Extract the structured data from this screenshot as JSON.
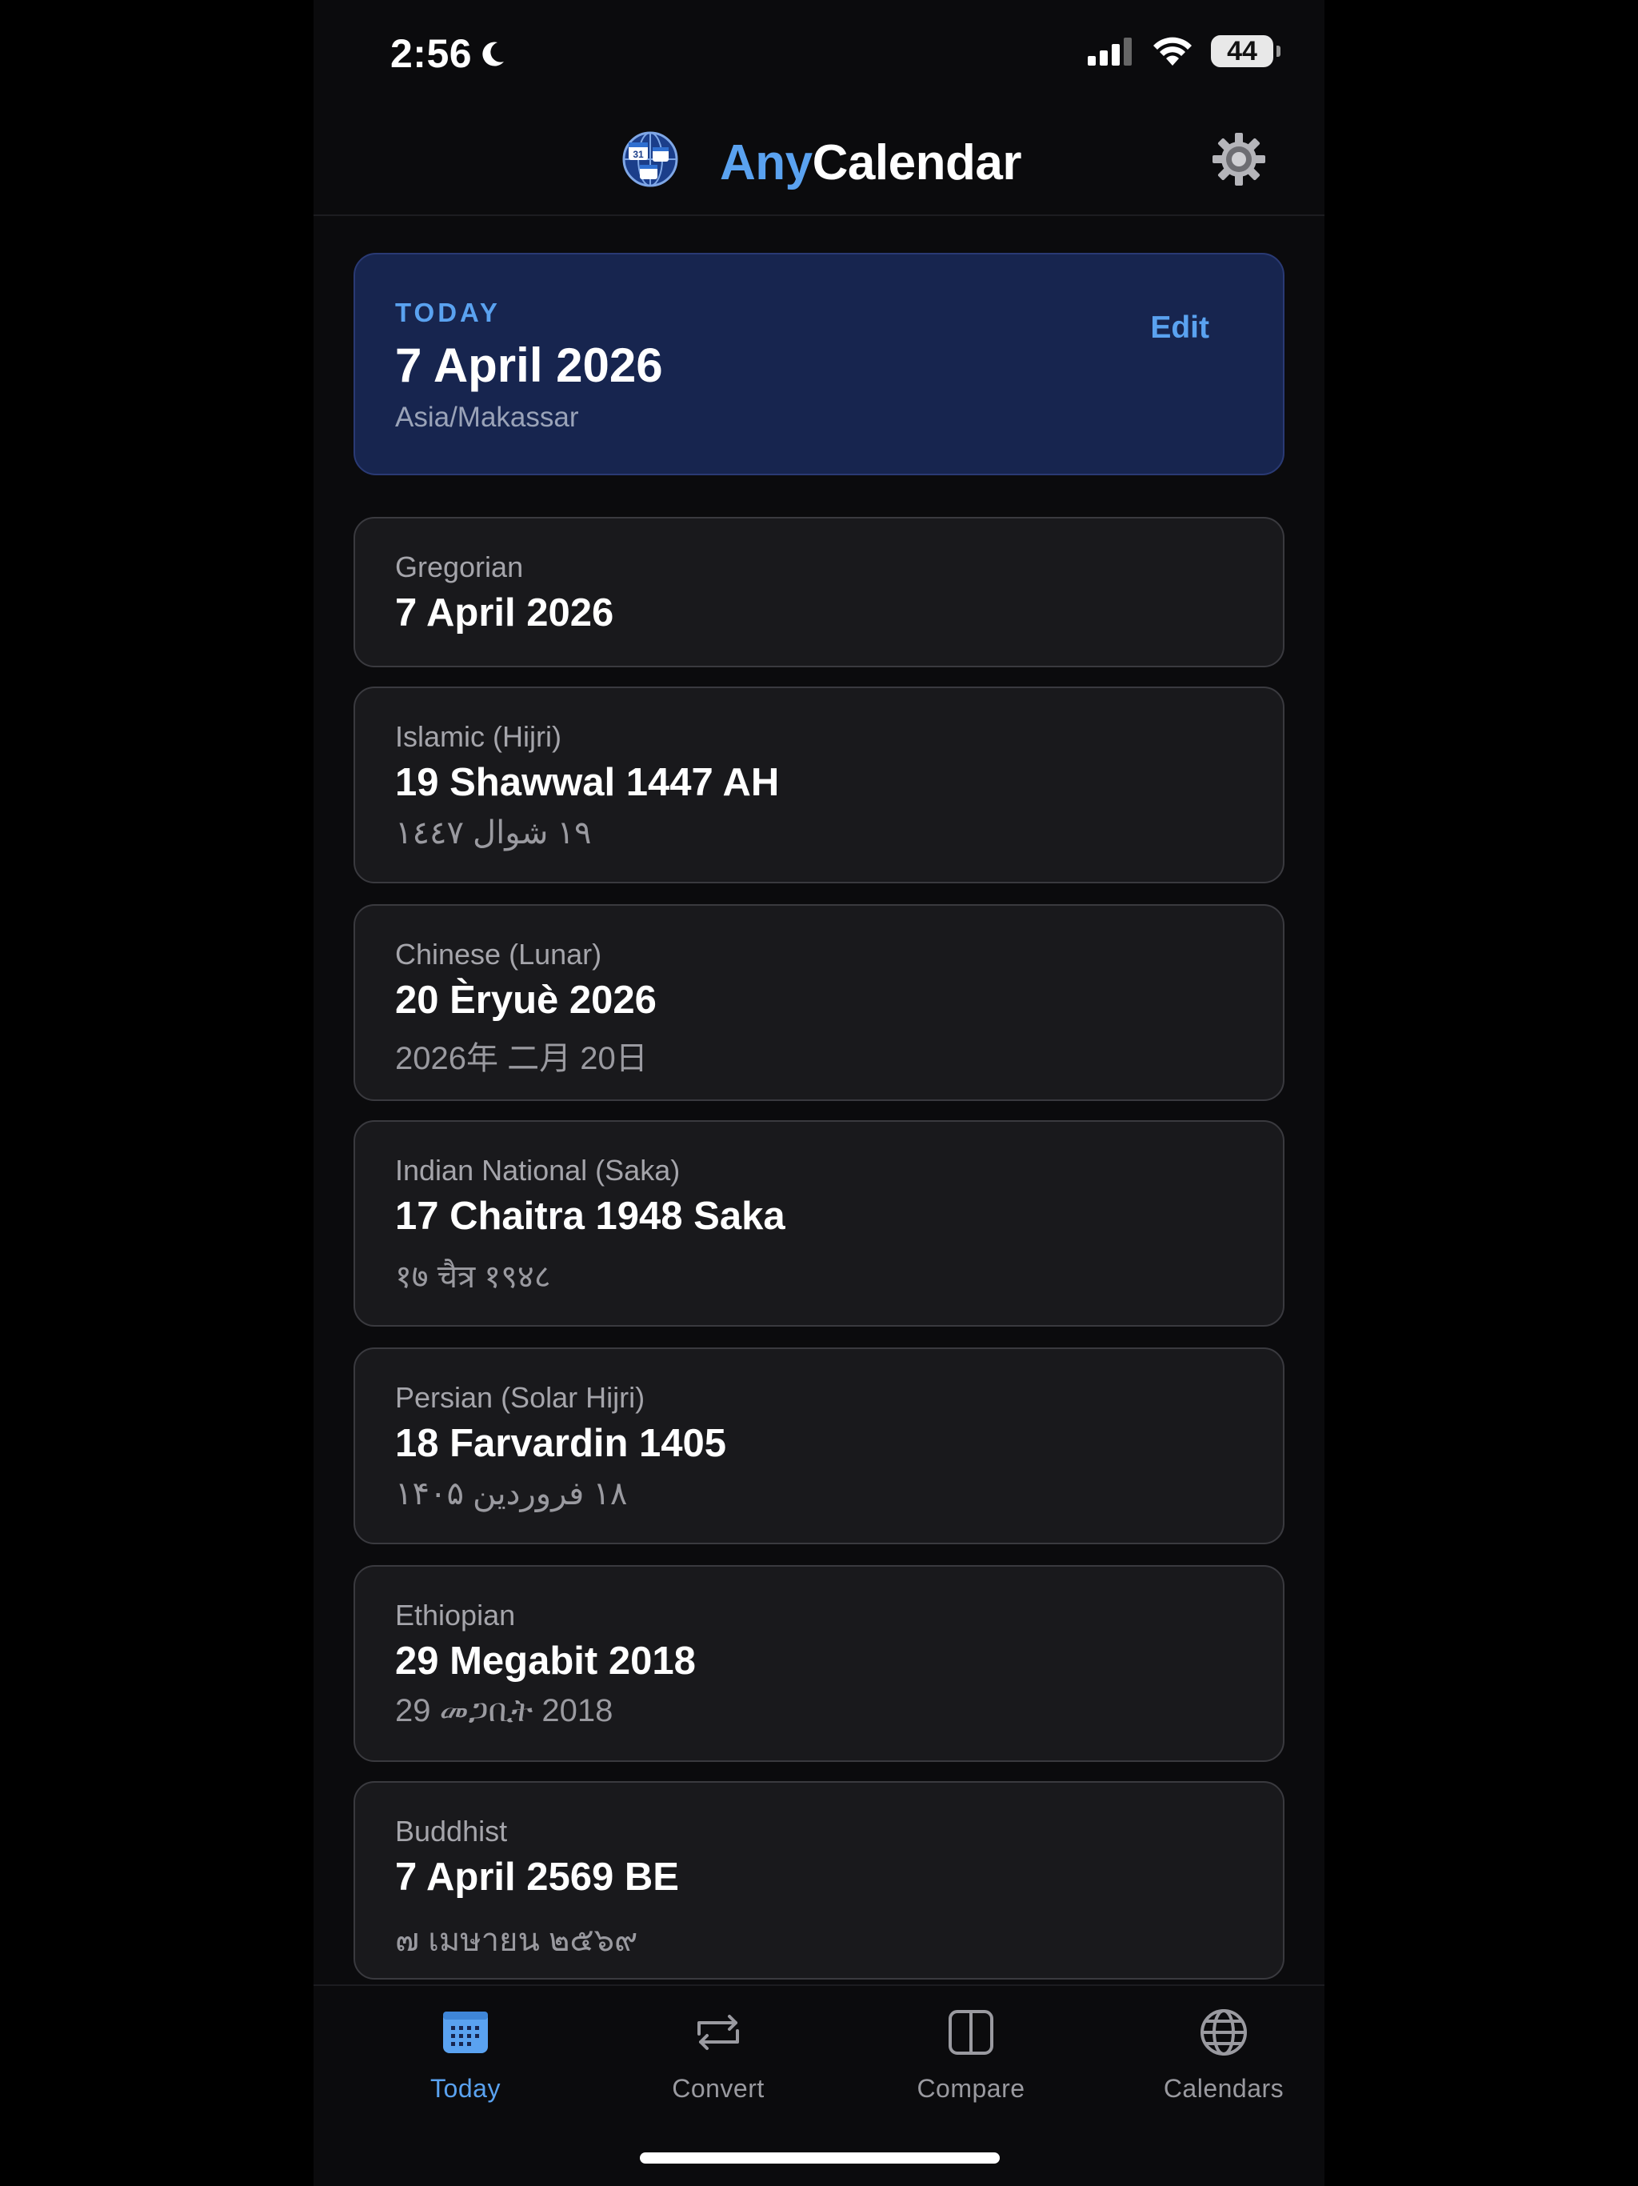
{
  "status_bar": {
    "time": "2:56",
    "battery": "44"
  },
  "header": {
    "title_accent": "Any",
    "title_rest": "Calendar"
  },
  "today": {
    "label": "TODAY",
    "date": "7 April 2026",
    "timezone": "Asia/Makassar",
    "edit_label": "Edit"
  },
  "calendars": [
    {
      "name": "Gregorian",
      "date": "7 April 2026",
      "native": ""
    },
    {
      "name": "Islamic (Hijri)",
      "date": "19 Shawwal 1447 AH",
      "native": "١٩ شوال ١٤٤٧"
    },
    {
      "name": "Chinese (Lunar)",
      "date": "20 Èryuè 2026",
      "native": "2026年 二月 20日"
    },
    {
      "name": "Indian National (Saka)",
      "date": "17 Chaitra 1948 Saka",
      "native": "१७ चैत्र १९४८"
    },
    {
      "name": "Persian (Solar Hijri)",
      "date": "18 Farvardin 1405",
      "native": "۱۸ فروردین ۱۴۰۵"
    },
    {
      "name": "Ethiopian",
      "date": "29 Megabit 2018",
      "native": "29 መጋቢት 2018"
    },
    {
      "name": "Buddhist",
      "date": "7 April 2569 BE",
      "native": "๗ เมษายน ๒๕๖๙"
    }
  ],
  "tabs": [
    {
      "label": "Today",
      "icon": "calendar-grid-icon",
      "active": true
    },
    {
      "label": "Convert",
      "icon": "convert-arrows-icon",
      "active": false
    },
    {
      "label": "Compare",
      "icon": "split-panel-icon",
      "active": false
    },
    {
      "label": "Calendars",
      "icon": "globe-icon",
      "active": false
    }
  ],
  "colors": {
    "accent": "#5aa2f0",
    "today_card": "#17254f",
    "card": "#19191c",
    "background": "#0b0b0d"
  }
}
